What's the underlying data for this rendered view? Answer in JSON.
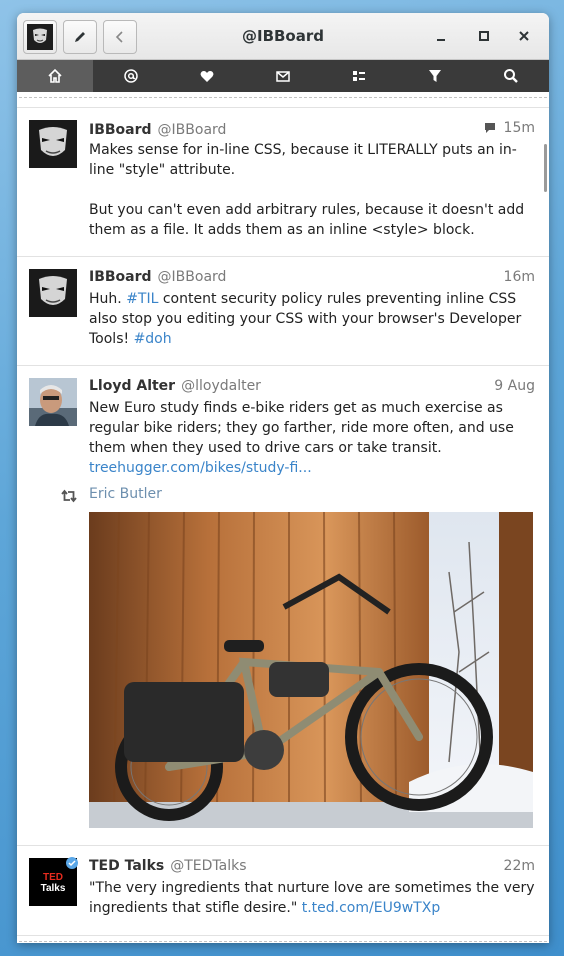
{
  "window": {
    "title": "@IBBoard"
  },
  "nav": {
    "items": [
      {
        "icon": "home-icon"
      },
      {
        "icon": "at-icon"
      },
      {
        "icon": "heart-icon"
      },
      {
        "icon": "mail-icon"
      },
      {
        "icon": "list-icon"
      },
      {
        "icon": "filter-icon"
      },
      {
        "icon": "search-icon"
      }
    ]
  },
  "tweets": [
    {
      "name": "IBBoard",
      "handle": "@IBBoard",
      "time": "15m",
      "text1": "Makes sense for in-line CSS, because it LITERALLY puts an in-line \"style\" attribute.",
      "text2": "But you can't even add arbitrary rules, because it doesn't add them as a file. It adds them as an inline <style> block."
    },
    {
      "name": "IBBoard",
      "handle": "@IBBoard",
      "time": "16m",
      "text_a": "Huh. ",
      "hashtag1": "#TIL",
      "text_b": " content security policy rules preventing inline CSS also stop you editing your CSS with your browser's Developer Tools! ",
      "hashtag2": "#doh"
    },
    {
      "name": "Lloyd Alter",
      "handle": "@lloydalter",
      "time": "9 Aug",
      "text": "New Euro study finds e-bike riders get as much exercise as regular bike riders; they go farther, ride more often, and use them when they used to drive cars or take transit. ",
      "link": "treehugger.com/bikes/study-fi...",
      "retweeted_by": "Eric Butler"
    },
    {
      "name": "TED Talks",
      "handle": "@TEDTalks",
      "time": "22m",
      "text": "\"The very ingredients that nurture love are sometimes the very ingredients that stifle desire.\" ",
      "link": "t.ted.com/EU9wTXp",
      "avatar_line1": "TED",
      "avatar_line2": "Talks"
    }
  ],
  "colors": {
    "link": "#3a84c9",
    "navbar": "#3a3a3a",
    "nav_active": "#5d5d5d"
  }
}
